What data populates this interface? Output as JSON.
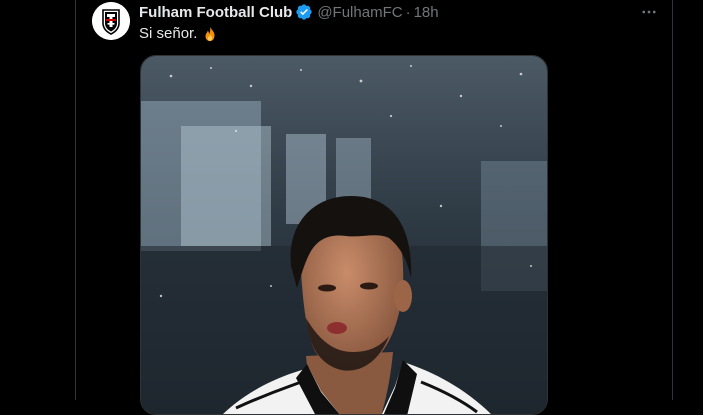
{
  "tweet": {
    "author_name": "Fulham Football Club",
    "handle": "@FulhamFC",
    "separator": "·",
    "time": "18h",
    "text": "Si señor.",
    "emoji": "fire-icon",
    "verified_icon": "verified-badge-icon",
    "more_icon": "more-horizontal-icon"
  },
  "colors": {
    "background": "#000000",
    "primary_text": "#e7e9ea",
    "secondary_text": "#71767b",
    "verified_blue": "#1d9bf0",
    "border": "#2f3336"
  }
}
